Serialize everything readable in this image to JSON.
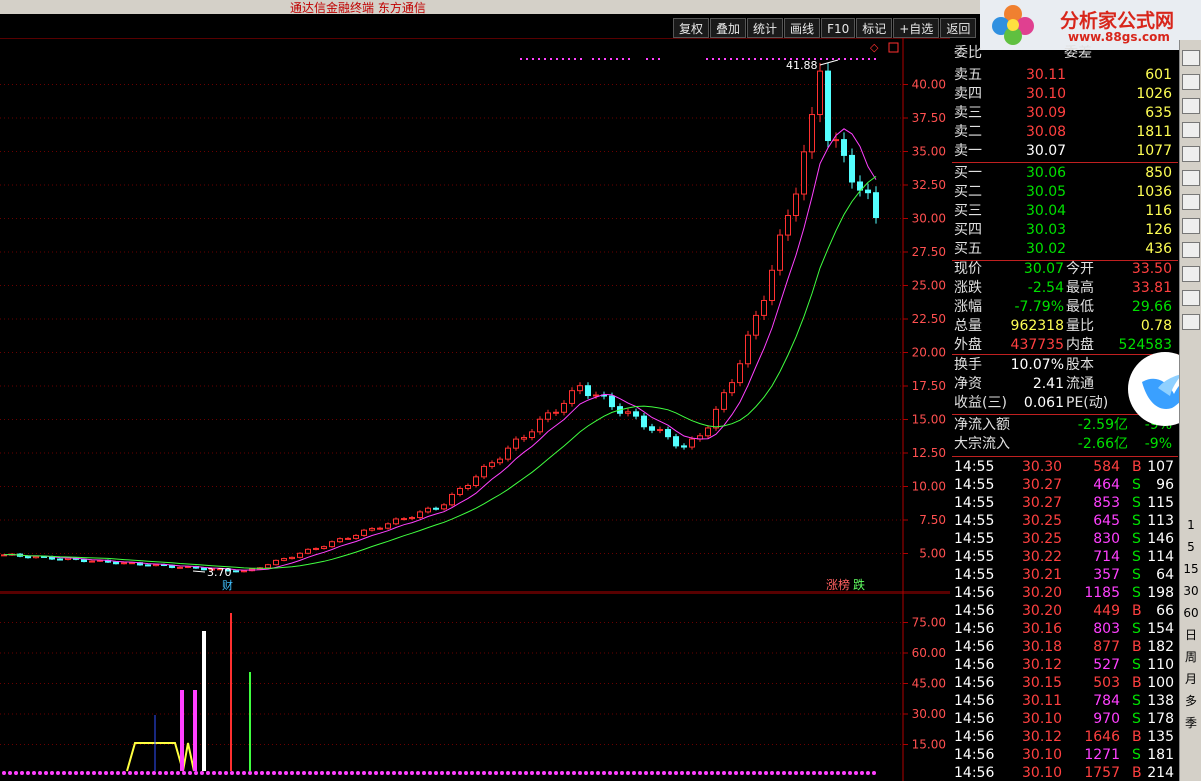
{
  "window": {
    "title": "通达信金融终端 东方通信"
  },
  "toolbar": {
    "buttons": [
      "复权",
      "叠加",
      "统计",
      "画线",
      "F10",
      "标记",
      "+自选",
      "返回"
    ]
  },
  "main_chart": {
    "y_ticks": [
      "40.00",
      "37.50",
      "35.00",
      "32.50",
      "30.00",
      "27.50",
      "25.00",
      "22.50",
      "20.00",
      "17.50",
      "15.00",
      "12.50",
      "10.00",
      "7.50",
      "5.00"
    ],
    "high_label": "41.88",
    "low_label": "3.70",
    "cai_marker": "财",
    "tag_up": "涨榜",
    "tag_down": "跌",
    "colors": {
      "up": "#ff3030",
      "down": "#54ffff",
      "ma_short": "#ff40ff",
      "ma_long": "#40ff40",
      "grid": "#8b0000"
    }
  },
  "sub_chart": {
    "y_ticks": [
      "75.00",
      "60.00",
      "45.00",
      "30.00",
      "15.00"
    ]
  },
  "logo": {
    "name": "分析家公式网",
    "url": "www.88gs.com"
  },
  "quote": {
    "header_left": "委比",
    "header_right": "委差",
    "asks": [
      {
        "label": "卖五",
        "price": "30.11",
        "vol": "601"
      },
      {
        "label": "卖四",
        "price": "30.10",
        "vol": "1026"
      },
      {
        "label": "卖三",
        "price": "30.09",
        "vol": "635"
      },
      {
        "label": "卖二",
        "price": "30.08",
        "vol": "1811"
      },
      {
        "label": "卖一",
        "price": "30.07",
        "vol": "1077"
      }
    ],
    "bids": [
      {
        "label": "买一",
        "price": "30.06",
        "vol": "850"
      },
      {
        "label": "买二",
        "price": "30.05",
        "vol": "1036"
      },
      {
        "label": "买三",
        "price": "30.04",
        "vol": "116"
      },
      {
        "label": "买四",
        "price": "30.03",
        "vol": "126"
      },
      {
        "label": "买五",
        "price": "30.02",
        "vol": "436"
      }
    ],
    "stats": [
      {
        "l1": "现价",
        "v1": "30.07",
        "l2": "今开",
        "v2": "33.50"
      },
      {
        "l1": "涨跌",
        "v1": "-2.54",
        "l2": "最高",
        "v2": "33.81"
      },
      {
        "l1": "涨幅",
        "v1": "-7.79%",
        "l2": "最低",
        "v2": "29.66"
      },
      {
        "l1": "总量",
        "v1": "962318",
        "l2": "量比",
        "v2": "0.78"
      },
      {
        "l1": "外盘",
        "v1": "437735",
        "l2": "内盘",
        "v2": "524583"
      }
    ],
    "fund": [
      {
        "l1": "换手",
        "v1": "10.07%",
        "l2": "股本",
        "v2": ""
      },
      {
        "l1": "净资",
        "v1": "2.41",
        "l2": "流通",
        "v2": ""
      },
      {
        "l1": "收益(三)",
        "v1": "0.061",
        "l2": "PE(动)",
        "v2": ""
      }
    ],
    "flow": [
      {
        "label": "净流入额",
        "value": "-2.59亿",
        "pct": "-9%"
      },
      {
        "label": "大宗流入",
        "value": "-2.66亿",
        "pct": "-9%"
      }
    ],
    "ticks": [
      {
        "t": "14:55",
        "p": "30.30",
        "v": "584",
        "s": "B",
        "n": "107"
      },
      {
        "t": "14:55",
        "p": "30.27",
        "v": "464",
        "s": "S",
        "n": "96"
      },
      {
        "t": "14:55",
        "p": "30.27",
        "v": "853",
        "s": "S",
        "n": "115"
      },
      {
        "t": "14:55",
        "p": "30.25",
        "v": "645",
        "s": "S",
        "n": "113"
      },
      {
        "t": "14:55",
        "p": "30.25",
        "v": "830",
        "s": "S",
        "n": "146"
      },
      {
        "t": "14:55",
        "p": "30.22",
        "v": "714",
        "s": "S",
        "n": "114"
      },
      {
        "t": "14:55",
        "p": "30.21",
        "v": "357",
        "s": "S",
        "n": "64"
      },
      {
        "t": "14:56",
        "p": "30.20",
        "v": "1185",
        "s": "S",
        "n": "198"
      },
      {
        "t": "14:56",
        "p": "30.20",
        "v": "449",
        "s": "B",
        "n": "66"
      },
      {
        "t": "14:56",
        "p": "30.16",
        "v": "803",
        "s": "S",
        "n": "154"
      },
      {
        "t": "14:56",
        "p": "30.18",
        "v": "877",
        "s": "B",
        "n": "182"
      },
      {
        "t": "14:56",
        "p": "30.12",
        "v": "527",
        "s": "S",
        "n": "110"
      },
      {
        "t": "14:56",
        "p": "30.15",
        "v": "503",
        "s": "B",
        "n": "100"
      },
      {
        "t": "14:56",
        "p": "30.11",
        "v": "784",
        "s": "S",
        "n": "138"
      },
      {
        "t": "14:56",
        "p": "30.10",
        "v": "970",
        "s": "S",
        "n": "178"
      },
      {
        "t": "14:56",
        "p": "30.12",
        "v": "1646",
        "s": "B",
        "n": "135"
      },
      {
        "t": "14:56",
        "p": "30.10",
        "v": "1271",
        "s": "S",
        "n": "181"
      },
      {
        "t": "14:56",
        "p": "30.10",
        "v": "1757",
        "s": "B",
        "n": "214"
      }
    ]
  },
  "sidebar": {
    "periods": [
      "1",
      "5",
      "15",
      "30",
      "60",
      "日",
      "周",
      "月",
      "多",
      "季"
    ]
  }
}
